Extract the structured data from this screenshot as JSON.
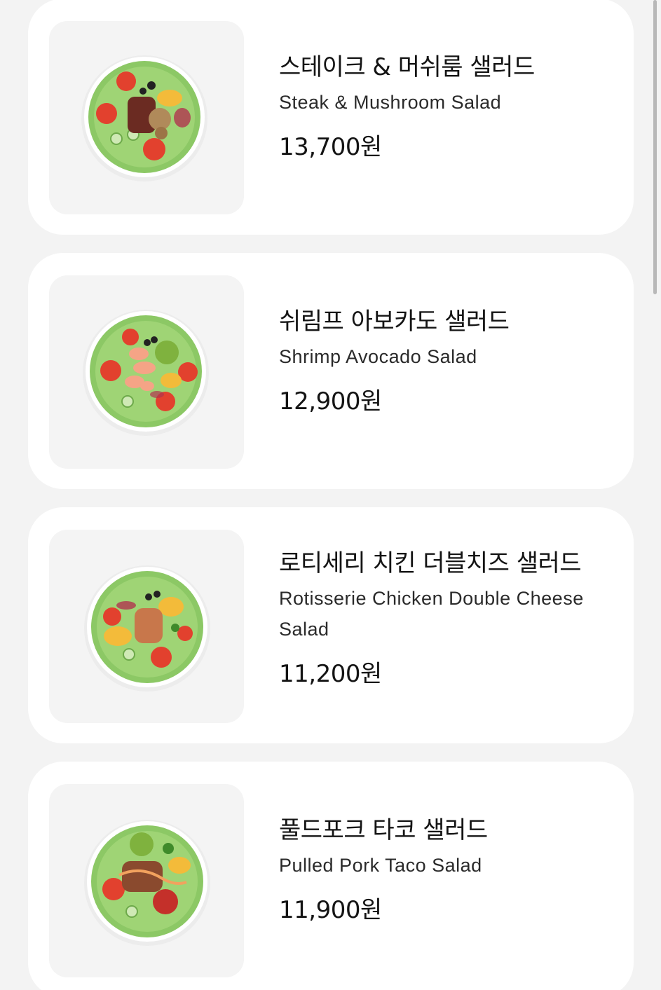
{
  "menu_items": [
    {
      "name_ko": "스테이크 & 머쉬룸 샐러드",
      "name_en": "Steak & Mushroom Salad",
      "price": "13,700원",
      "image_icon": "steak-mushroom-salad-bowl"
    },
    {
      "name_ko": "쉬림프 아보카도 샐러드",
      "name_en": "Shrimp Avocado Salad",
      "price": "12,900원",
      "image_icon": "shrimp-avocado-salad-bowl"
    },
    {
      "name_ko": "로티세리 치킨 더블치즈 샐러드",
      "name_en": "Rotisserie Chicken Double Cheese Salad",
      "price": "11,200원",
      "image_icon": "rotisserie-chicken-salad-bowl"
    },
    {
      "name_ko": "풀드포크 타코 샐러드",
      "name_en": "Pulled Pork Taco Salad",
      "price": "11,900원",
      "image_icon": "pulled-pork-taco-salad-bowl"
    }
  ],
  "colors": {
    "background": "#f3f3f3",
    "card": "#ffffff",
    "thumb_bg": "#f4f4f4",
    "lettuce": "#8cc865",
    "tomato": "#e2412e"
  }
}
